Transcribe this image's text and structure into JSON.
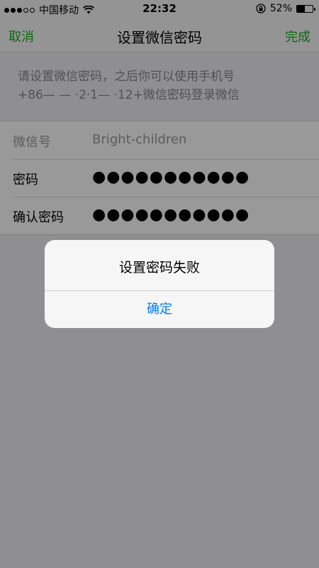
{
  "status_bar": {
    "carrier": "中国移动",
    "time": "22:32",
    "battery_text": "52%",
    "battery_level": 0.52,
    "signal_bars_filled": 3,
    "signal_bars_total": 5
  },
  "nav": {
    "cancel_label": "取消",
    "title": "设置微信密码",
    "done_label": "完成"
  },
  "hint": {
    "line1": "请设置微信密码，之后你可以使用手机号",
    "line2": "+86— — ·2·1— ·12+微信密码登录微信"
  },
  "form": {
    "rows": [
      {
        "label": "微信号",
        "value": "Bright-children"
      },
      {
        "label": "密码",
        "value": "●●●●●●●●●●●"
      },
      {
        "label": "确认密码",
        "value": "●●●●●●●●●●●"
      }
    ]
  },
  "alert": {
    "title": "设置密码失败",
    "confirm_label": "确定"
  },
  "colors": {
    "accent_green": "#1aad19",
    "link_blue": "#007aff"
  }
}
